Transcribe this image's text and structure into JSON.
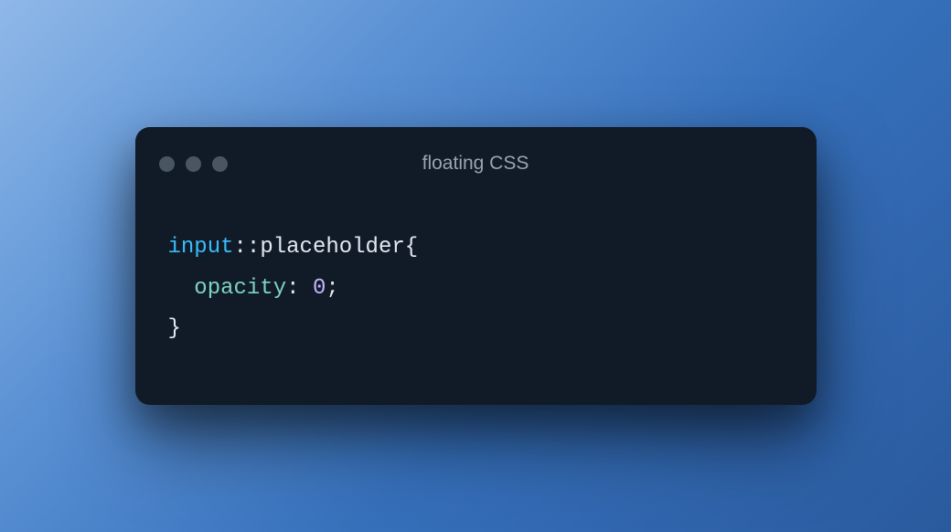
{
  "window": {
    "title": "floating CSS"
  },
  "code": {
    "selector": "input",
    "pseudo_sep": "::",
    "pseudo": "placeholder",
    "brace_open": "{",
    "property": "opacity",
    "colon": ":",
    "space": " ",
    "value": "0",
    "semicolon": ";",
    "brace_close": "}"
  }
}
